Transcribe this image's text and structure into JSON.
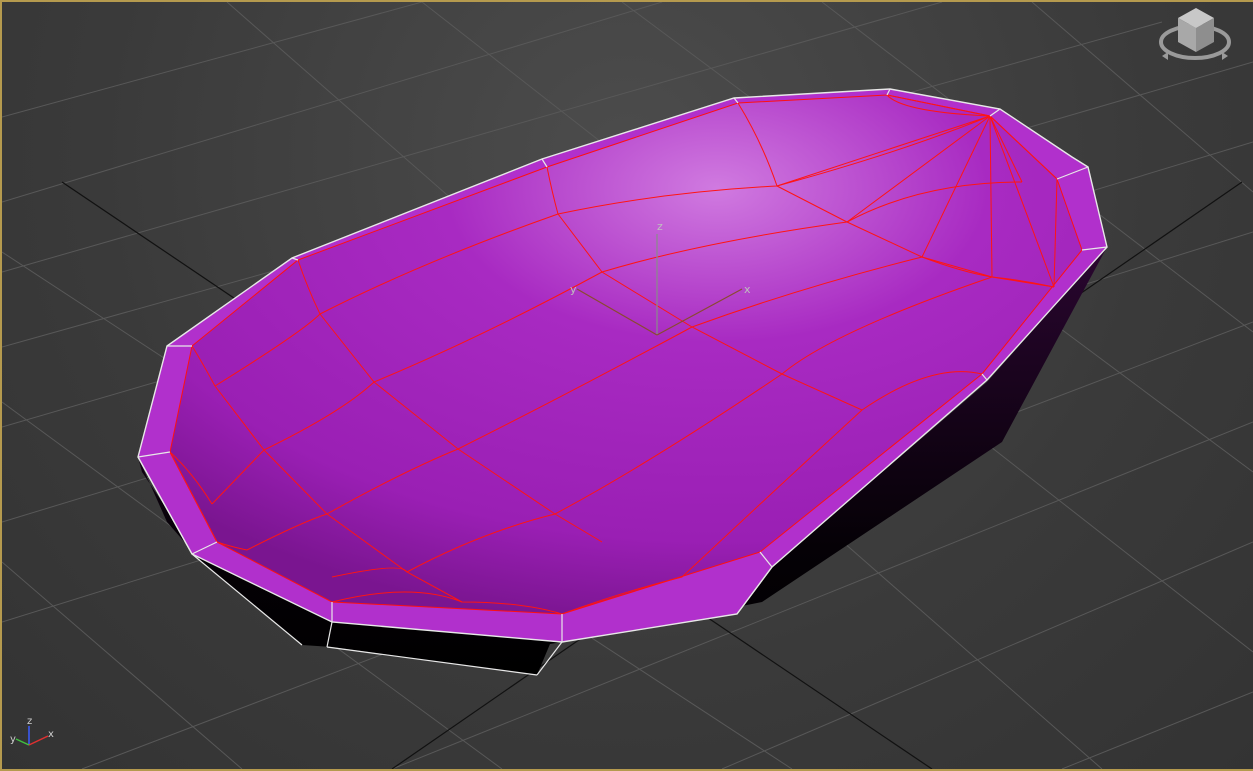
{
  "viewport": {
    "active_border_color": "#b59a4e",
    "object_color": "#a829c2",
    "wire_color": "#ff1010"
  },
  "gizmo": {
    "x_label": "x",
    "y_label": "y",
    "z_label": "z"
  },
  "axis_tripod": {
    "x_label": "x",
    "y_label": "y",
    "z_label": "z"
  },
  "viewcube": {
    "icon": "viewcube-icon"
  }
}
